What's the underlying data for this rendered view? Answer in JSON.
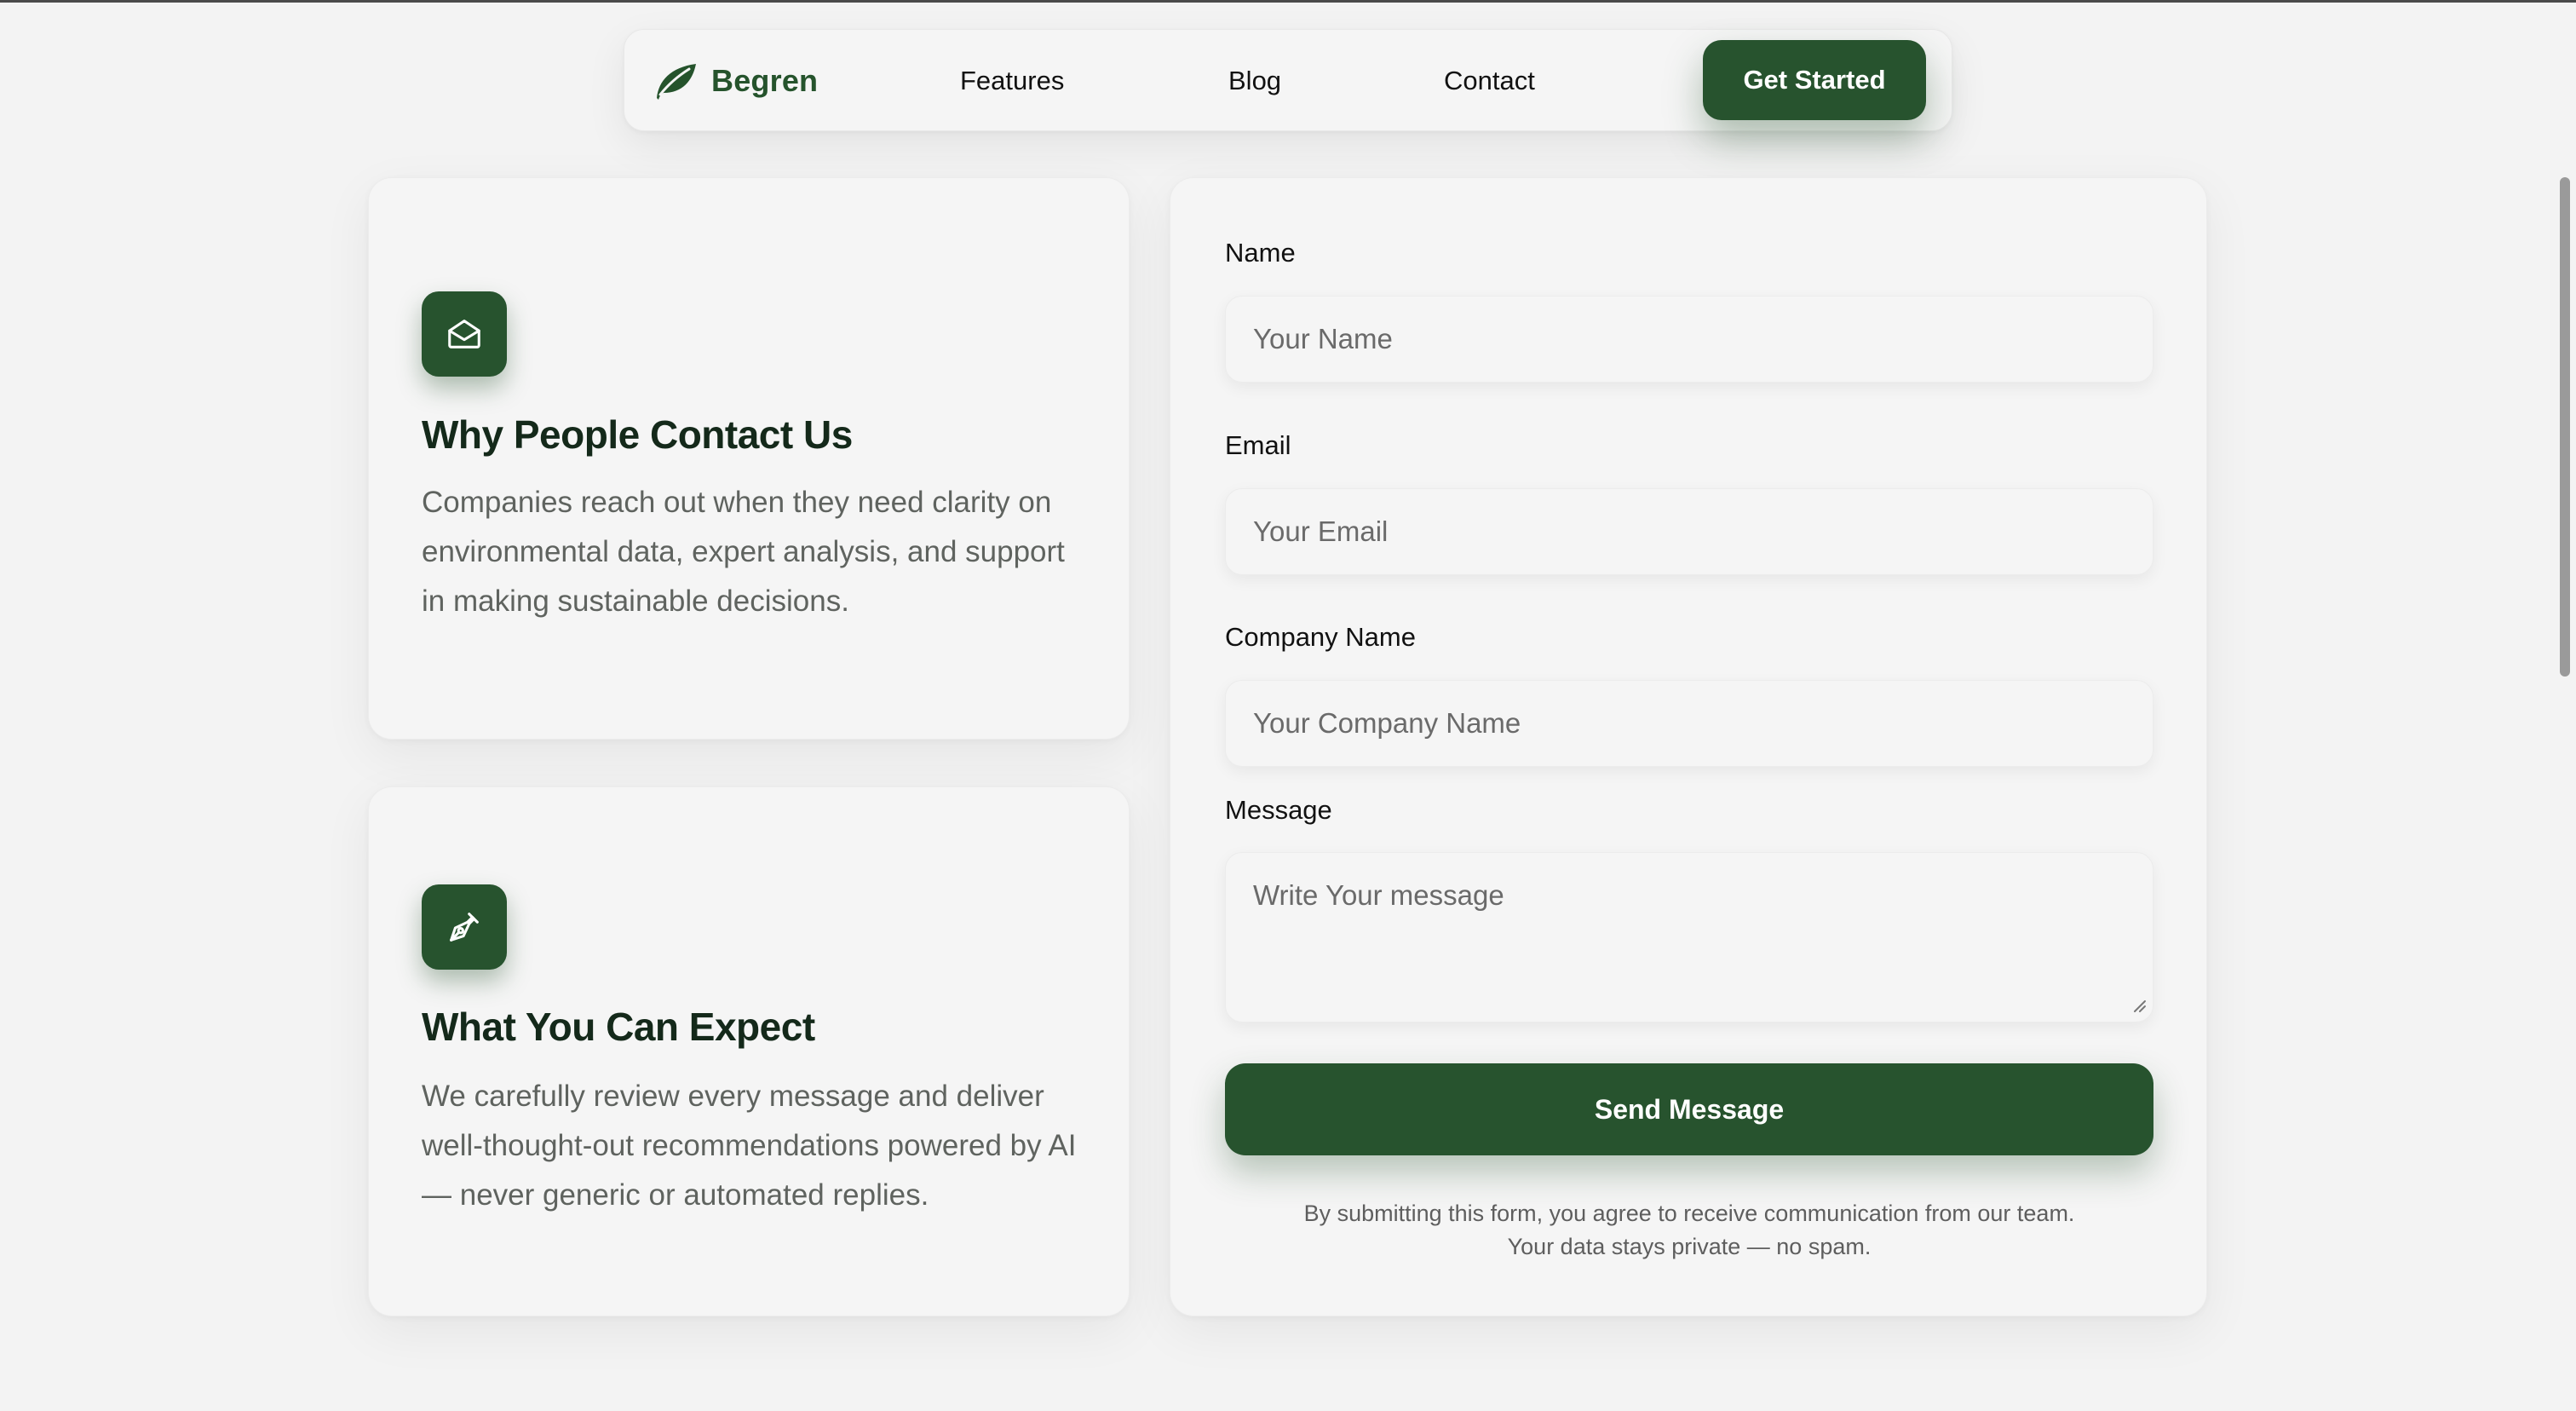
{
  "nav": {
    "brand": "Begren",
    "links": [
      "Features",
      "Blog",
      "Contact"
    ],
    "cta": "Get Started"
  },
  "info_cards": [
    {
      "icon": "envelope-open-icon",
      "title": "Why People Contact Us",
      "text": "Companies reach out when they need clarity on environmental data, expert analysis, and support in making sustainable decisions."
    },
    {
      "icon": "pen-nib-icon",
      "title": "What You Can Expect",
      "text": "We carefully review every message and deliver well-thought-out recommendations powered by AI — never generic or automated replies."
    }
  ],
  "form": {
    "name": {
      "label": "Name",
      "placeholder": "Your Name"
    },
    "email": {
      "label": "Email",
      "placeholder": "Your Email"
    },
    "company": {
      "label": "Company Name",
      "placeholder": "Your Company Name"
    },
    "message": {
      "label": "Message",
      "placeholder": "Write Your message"
    },
    "submit": "Send Message",
    "disclaimer_line1": "By submitting this form, you agree to receive communication from our team.",
    "disclaimer_line2": "Your data stays private — no spam."
  },
  "colors": {
    "brand_green": "#27532e",
    "background": "#f3f3f3",
    "card": "#f5f5f5"
  }
}
